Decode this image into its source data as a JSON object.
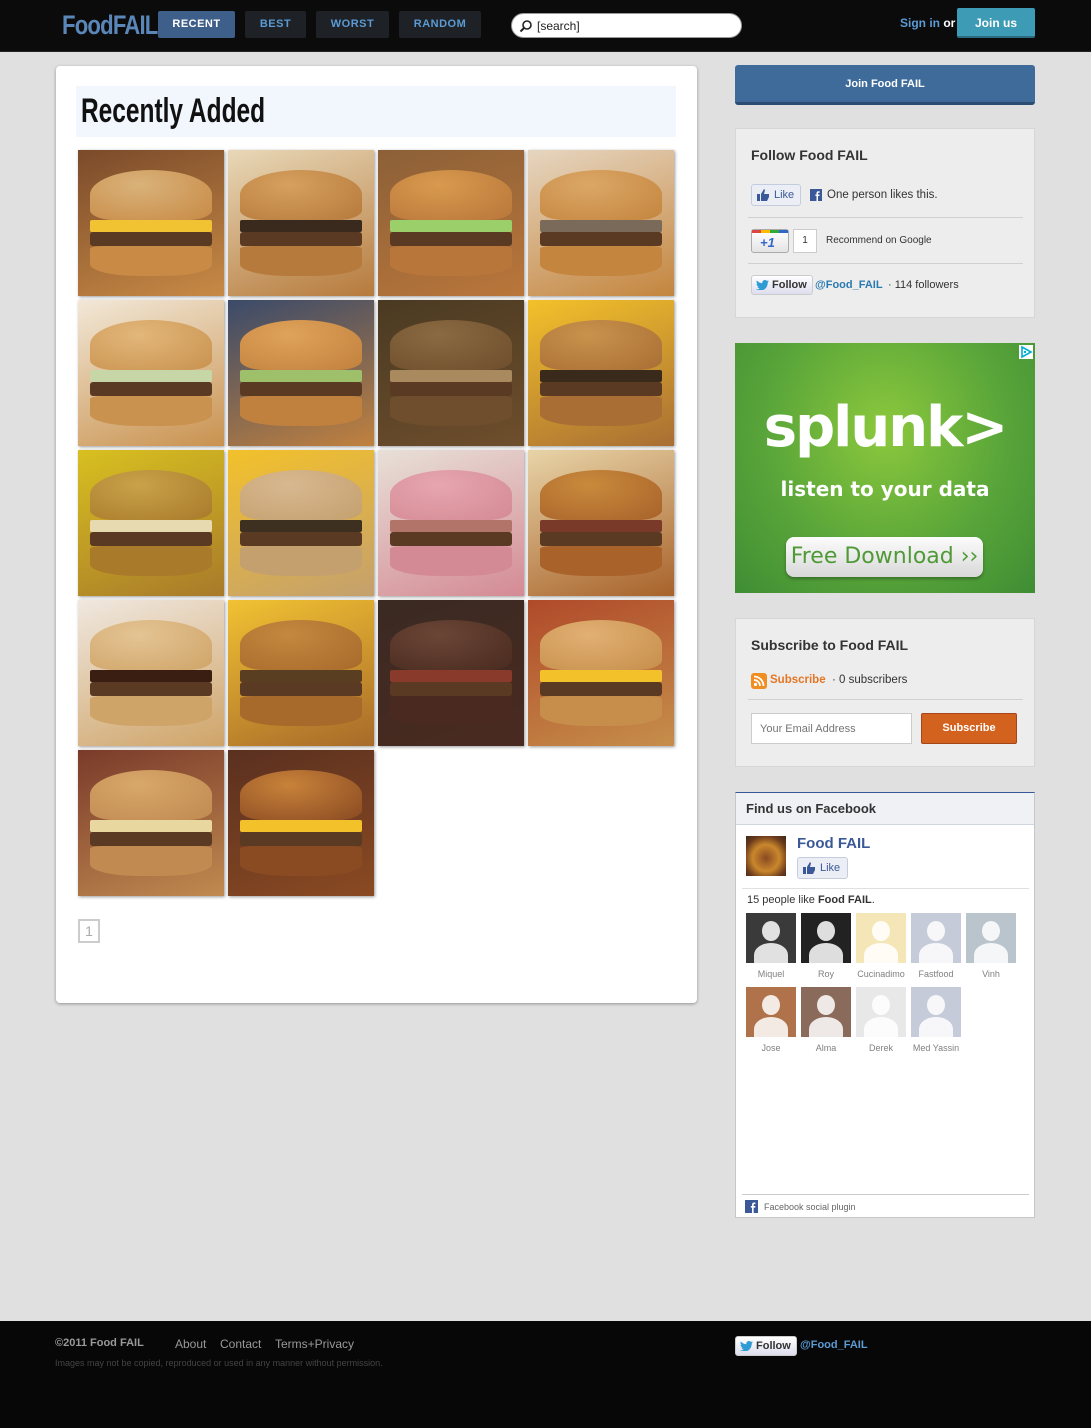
{
  "header": {
    "logo": "FoodFAIL",
    "nav": [
      "RECENT",
      "BEST",
      "WORST",
      "RANDOM"
    ],
    "active_nav": "RECENT",
    "search_value": "[search]",
    "signin_label": "Sign in",
    "or_label": "or",
    "joinus_label": "Join us"
  },
  "main": {
    "title": "Recently Added",
    "thumbnails": [
      {
        "name": "cheeseburger"
      },
      {
        "name": "double-burger"
      },
      {
        "name": "chicken-sandwich"
      },
      {
        "name": "sesame-burger"
      },
      {
        "name": "lettuce-burger"
      },
      {
        "name": "fish-sandwich"
      },
      {
        "name": "smothered-patty"
      },
      {
        "name": "double-cheese-burger"
      },
      {
        "name": "chicken-strip"
      },
      {
        "name": "tomato-cheeseburger"
      },
      {
        "name": "plain-bun-burger"
      },
      {
        "name": "bacon-burger"
      },
      {
        "name": "bbq-rib-sandwich"
      },
      {
        "name": "cheeseburger-2"
      },
      {
        "name": "bbq-sandwich"
      },
      {
        "name": "bacon-cheeseburger"
      },
      {
        "name": "melt-sandwich"
      },
      {
        "name": "triple-bacon-burger"
      }
    ],
    "pager": "1"
  },
  "sidebar": {
    "join_label": "Join Food FAIL",
    "follow": {
      "title": "Follow Food FAIL",
      "like_label": "Like",
      "like_text": "One person likes this.",
      "plus_label": "+1",
      "plus_count": "1",
      "recommend_text": "Recommend on Google",
      "twitter_follow": "Follow",
      "twitter_handle": "@Food_FAIL",
      "twitter_followers": "· 114 followers"
    },
    "ad": {
      "logo": "splunk>",
      "tagline": "listen to your data",
      "button": "Free Download ››"
    },
    "subscribe": {
      "title": "Subscribe to Food FAIL",
      "link": "Subscribe",
      "count": "· 0 subscribers",
      "email_placeholder": "Your Email Address",
      "button": "Subscribe"
    },
    "facebook": {
      "header": "Find us on Facebook",
      "page_name": "Food FAIL",
      "like_label": "Like",
      "count_text": "15 people like",
      "count_page": "Food FAIL",
      "faces": [
        "Miquel",
        "Roy",
        "Cucinadimo",
        "Fastfood",
        "Vinh",
        "Jose",
        "Alma",
        "Derek",
        "Med Yassin"
      ],
      "plugin_label": "Facebook social plugin"
    }
  },
  "footer": {
    "copyright": "©2011 Food FAIL",
    "links": [
      "About",
      "Contact",
      "Terms+Privacy"
    ],
    "note": "Images may not be copied, reproduced or used in any manner without permission.",
    "twitter_follow": "Follow",
    "twitter_handle": "@Food_FAIL"
  }
}
